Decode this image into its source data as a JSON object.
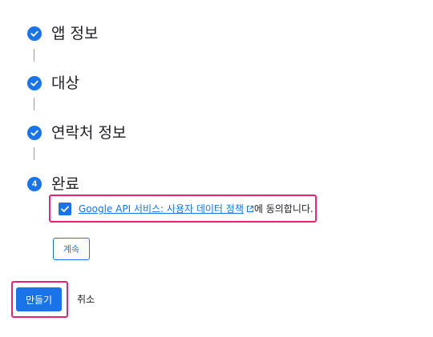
{
  "steps": [
    {
      "title": "앱 정보",
      "state": "complete"
    },
    {
      "title": "대상",
      "state": "complete"
    },
    {
      "title": "연락처 정보",
      "state": "complete"
    },
    {
      "title": "완료",
      "state": "current",
      "number": "4"
    }
  ],
  "consent": {
    "checked": true,
    "link_text": "Google API 서비스: 사용자 데이터 정책",
    "suffix": "에 동의합니다.",
    "icon": "external-link-icon"
  },
  "buttons": {
    "continue": "계속",
    "create": "만들기",
    "cancel": "취소"
  },
  "colors": {
    "accent": "#1a73e8",
    "highlight": "#e8226e"
  }
}
